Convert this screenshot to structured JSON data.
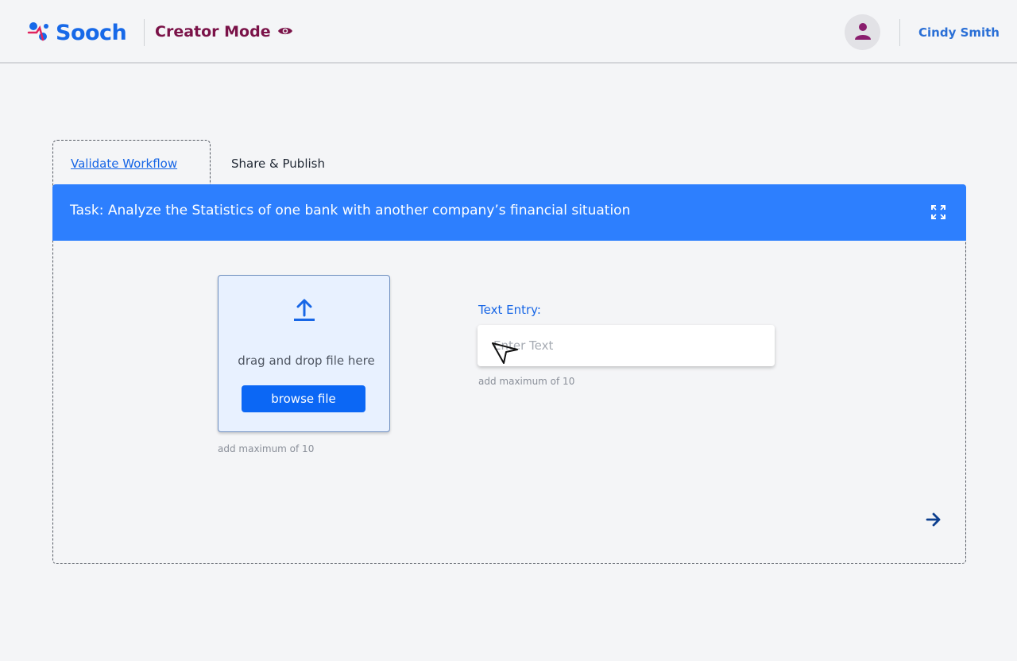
{
  "header": {
    "brand": "Sooch",
    "mode_label": "Creator Mode",
    "user_name": "Cindy Smith"
  },
  "tabs": [
    {
      "label": "Validate Workflow",
      "active": true
    },
    {
      "label": "Share & Publish",
      "active": false
    }
  ],
  "task": {
    "title": "Task: Analyze the Statistics of one bank with another company’s financial situation"
  },
  "upload": {
    "drag_text": "drag and drop file here",
    "button_label": "browse file",
    "hint": "add maximum of 10"
  },
  "text_entry": {
    "label": "Text Entry:",
    "placeholder": "Enter Text",
    "value": "",
    "hint": "add maximum of 10"
  },
  "icons": {
    "logo": "sooch-logo-icon",
    "mode": "eye-icon",
    "avatar": "user-icon",
    "expand": "expand-icon",
    "upload": "upload-icon",
    "next": "arrow-right-icon"
  },
  "colors": {
    "brand": "#1769e8",
    "mode": "#7a1248",
    "task_bar": "#2d7ffe",
    "primary_button": "#0b67f5"
  }
}
